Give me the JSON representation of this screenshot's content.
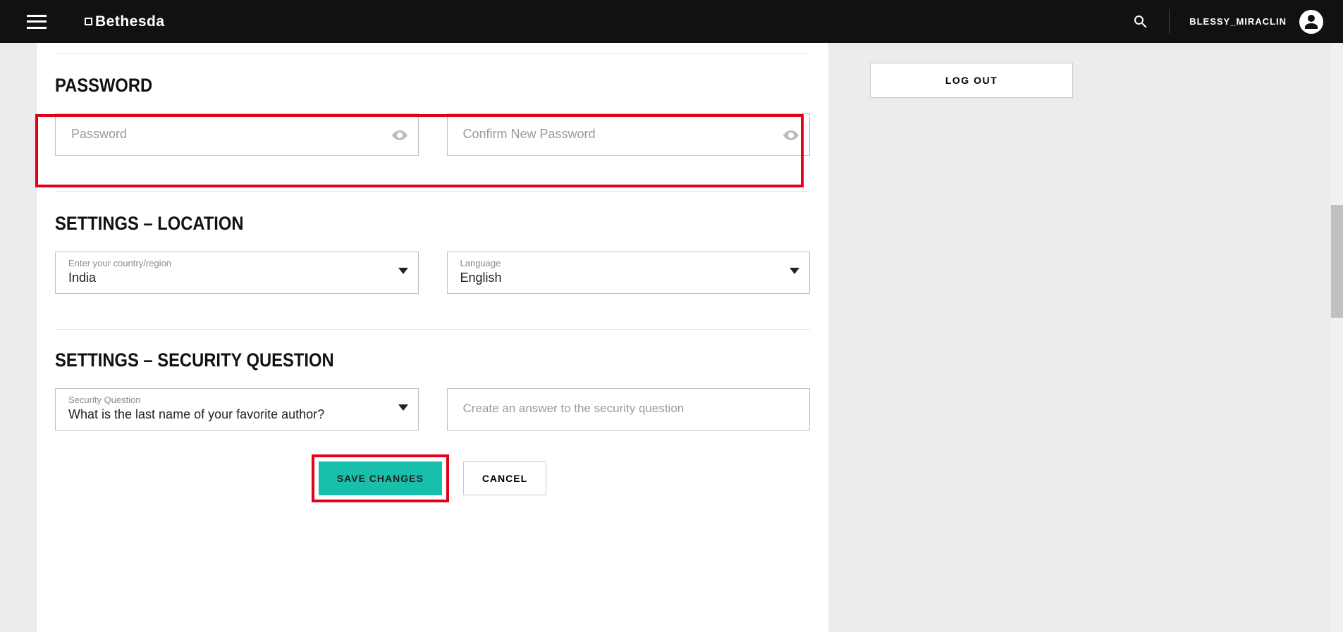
{
  "header": {
    "brand": "Bethesda",
    "username": "BLESSY_MIRACLIN"
  },
  "sidebar": {
    "logout_label": "LOG OUT"
  },
  "sections": {
    "password": {
      "title": "PASSWORD",
      "password_placeholder": "Password",
      "confirm_placeholder": "Confirm New Password"
    },
    "location": {
      "title": "SETTINGS – LOCATION",
      "country_label": "Enter your country/region",
      "country_value": "India",
      "language_label": "Language",
      "language_value": "English"
    },
    "security": {
      "title": "SETTINGS – SECURITY QUESTION",
      "question_label": "Security Question",
      "question_value": "What is the last name of your favorite author?",
      "answer_placeholder": "Create an answer to the security question"
    }
  },
  "buttons": {
    "save": "SAVE CHANGES",
    "cancel": "CANCEL"
  }
}
